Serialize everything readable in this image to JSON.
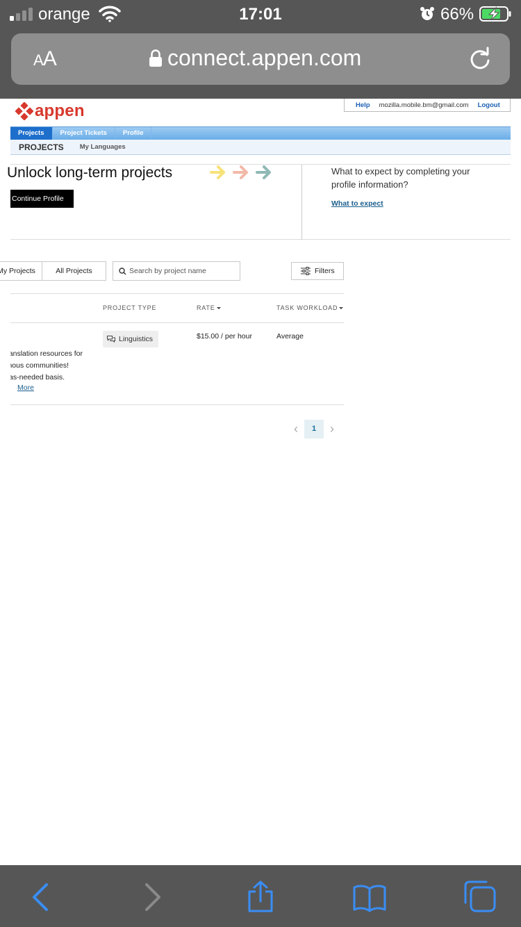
{
  "status_bar": {
    "carrier": "orange",
    "time": "17:01",
    "battery_percent": "66%",
    "signal_bars_active": 1,
    "signal_bars_total": 4
  },
  "safari": {
    "text_size_label": "AA",
    "url": "connect.appen.com"
  },
  "header": {
    "logo_text": "appen",
    "brand_color": "#d8382d",
    "help_link": "Help",
    "user_email": "mozilla.mobile.bm@gmail.com",
    "logout_link": "Logout"
  },
  "nav": {
    "tabs": [
      {
        "label": "Projects",
        "active": true
      },
      {
        "label": "Project Tickets",
        "active": false
      },
      {
        "label": "Profile",
        "active": false
      }
    ],
    "subnav_title": "PROJECTS",
    "subnav_link": "My Languages"
  },
  "banner": {
    "heading": "Unlock long-term projects",
    "continue_button": "Continue Profile",
    "expect_question": "What to expect by completing your profile information?",
    "expect_link": "What to expect",
    "arrow_colors": [
      "#f7e27a",
      "#f2b9a8",
      "#8fb9b5"
    ]
  },
  "filters": {
    "tab_my_projects": "My Projects",
    "tab_all_projects": "All Projects",
    "search_placeholder": "Search by project name",
    "filters_button": "Filters"
  },
  "table": {
    "headers": {
      "project_type": "PROJECT TYPE",
      "rate": "RATE",
      "task_workload": "TASK WORKLOAD"
    },
    "rows": [
      {
        "project_type": "Linguistics",
        "rate": "$15.00 / per hour",
        "task_workload": "Average",
        "description_lines": [
          "translation resources for",
          "igenous communities!",
          "as-needed basis."
        ],
        "more_link": "More"
      }
    ]
  },
  "pagination": {
    "current_page": "1"
  }
}
